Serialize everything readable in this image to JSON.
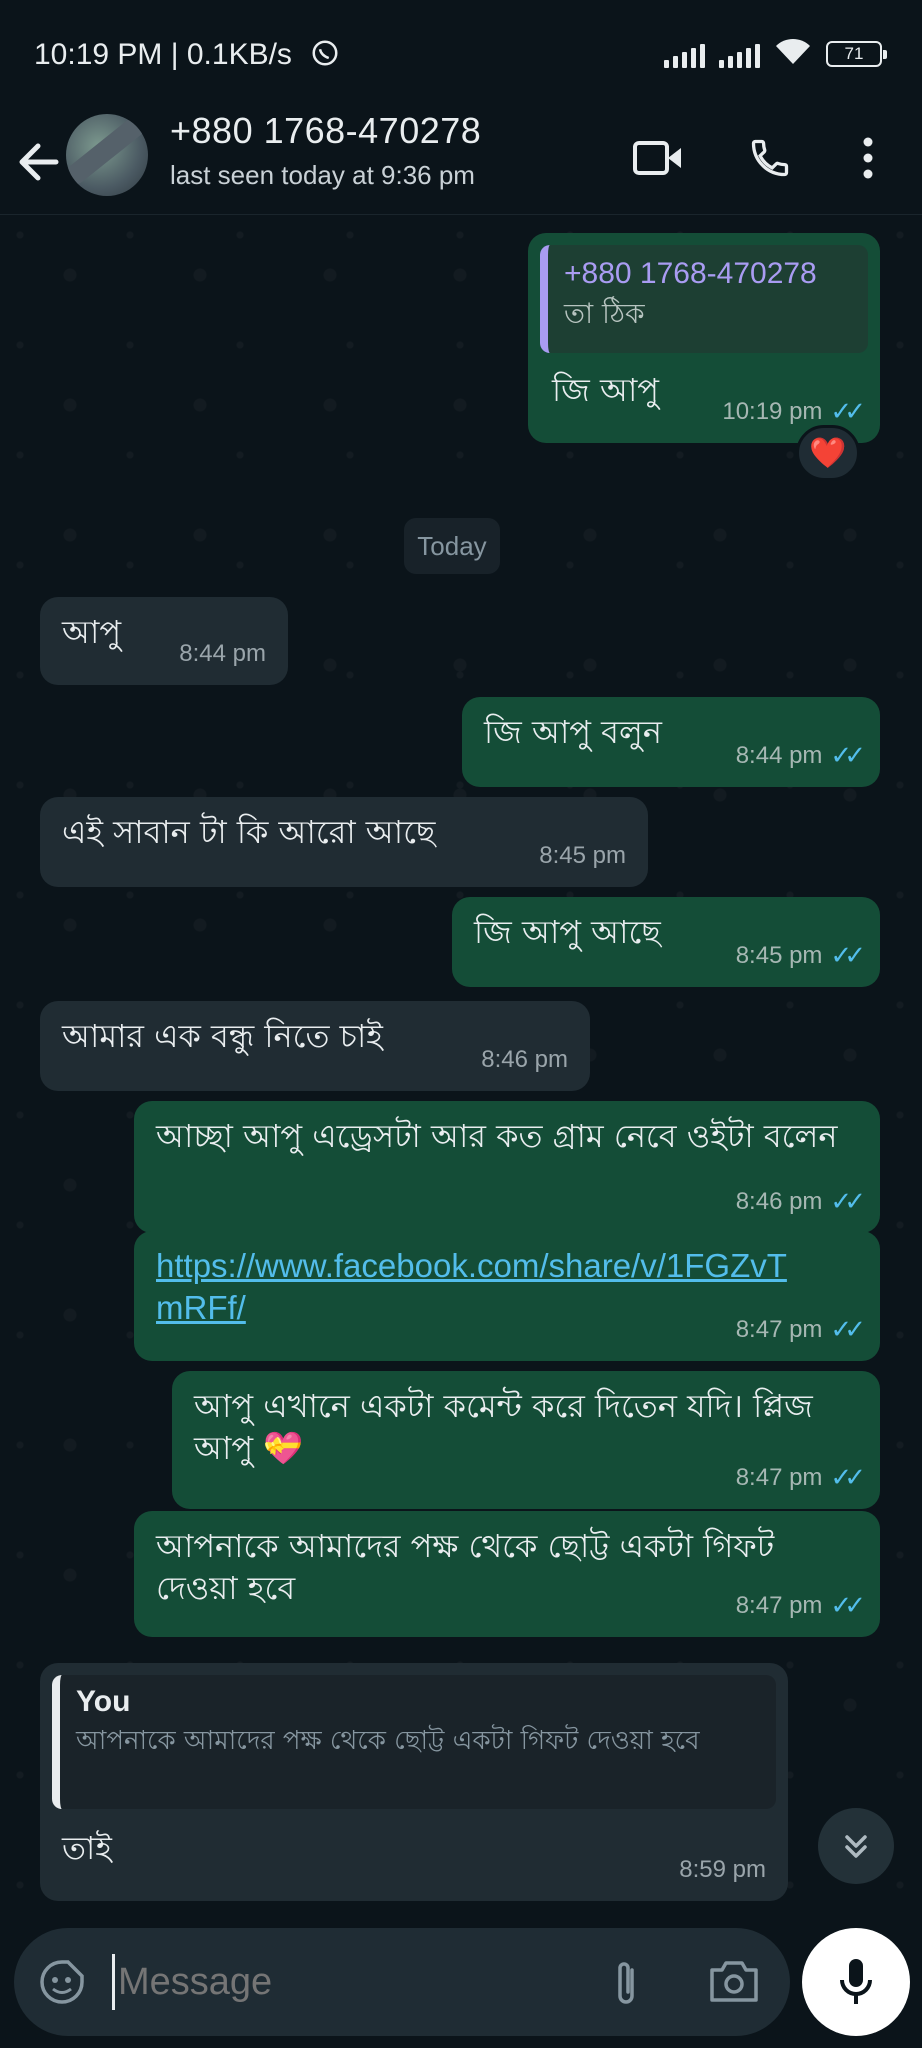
{
  "status_bar": {
    "time": "10:19 PM | 0.1KB/s",
    "battery": "71"
  },
  "header": {
    "contact_name": "+880 1768-470278",
    "last_seen": "last seen today at 9:36 pm"
  },
  "chat": {
    "quoted_out": {
      "quote_author": "+880 1768-470278",
      "quote_text": "তা ঠিক",
      "text": "জি আপু",
      "time": "10:19 pm",
      "reaction": "❤️"
    },
    "day_divider": "Today",
    "messages": [
      {
        "dir": "in",
        "text": "আপু",
        "time": "8:44 pm"
      },
      {
        "dir": "out",
        "text": "জি আপু বলুন",
        "time": "8:44 pm"
      },
      {
        "dir": "in",
        "text": "এই সাবান টা কি আরো আছে",
        "time": "8:45 pm"
      },
      {
        "dir": "out",
        "text": "জি আপু আছে",
        "time": "8:45 pm"
      },
      {
        "dir": "in",
        "text": "আমার এক বন্ধু নিতে চাই",
        "time": "8:46 pm"
      },
      {
        "dir": "out",
        "text": "আচ্ছা আপু এড্রেসটা আর কত গ্রাম নেবে ওইটা বলেন",
        "time": "8:46 pm"
      },
      {
        "dir": "out",
        "text": "https://www.facebook.com/share/v/1FGZvTmRFf/",
        "time": "8:47 pm"
      },
      {
        "dir": "out",
        "text": "আপু এখানে একটা কমেন্ট করে দিতেন যদি। প্লিজ আপু 💝",
        "time": "8:47 pm"
      },
      {
        "dir": "out",
        "text": "আপনাকে আমাদের পক্ষ থেকে ছোট্ট একটা গিফট দেওয়া হবে",
        "time": "8:47 pm"
      }
    ],
    "last_reply": {
      "quote_author": "You",
      "quote_text": "আপনাকে আমাদের পক্ষ থেকে ছোট্ট একটা গিফট দেওয়া হবে",
      "text": "তাই",
      "time": "8:59 pm"
    }
  },
  "composer": {
    "placeholder": "Message"
  },
  "colors": {
    "background": "#0b141a",
    "outgoing_bubble": "#144d37",
    "incoming_bubble": "#202c33",
    "read_ticks": "#53bdeb"
  }
}
